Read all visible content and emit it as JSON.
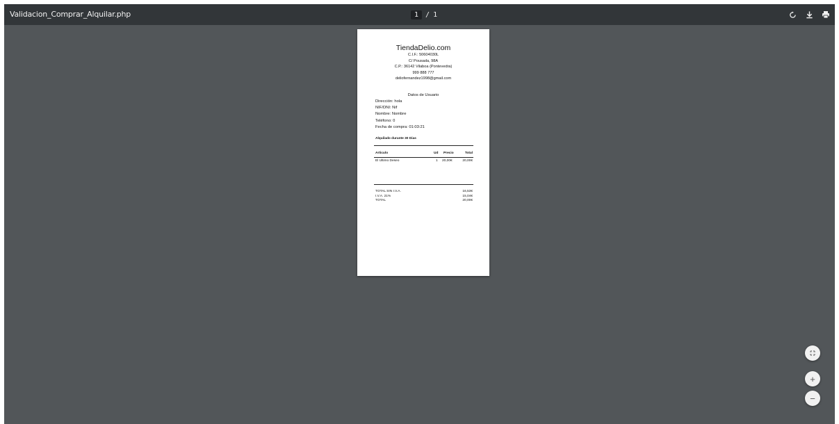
{
  "toolbar": {
    "title": "Validacion_Comprar_Alquilar.php",
    "current_page": "1",
    "page_separator": "/",
    "total_pages": "1",
    "icons": [
      "rotate-icon",
      "download-icon",
      "print-icon"
    ]
  },
  "document": {
    "shop_name": "TiendaDelio.com",
    "cif": "C.I.F.: 50604030L",
    "street": "C/ Pousada, 98A",
    "postal": "C.P.: 36142 Vilaboa (Pontevedra)",
    "phone": "999 888 777",
    "email": "deliofernandez1998@gmail.com",
    "user_section_title": "Datos de Usuario",
    "user": {
      "address": "Dirección: hola",
      "nif": "NIF/DNI: Nif",
      "name": "Nombre: Nombre",
      "phone": "Teléfono: 0",
      "date": "Fecha de compra: 01:03:21"
    },
    "rental_note": "Alquilado durante 30 Dias",
    "table": {
      "headers": [
        "Articulo",
        "Ud",
        "Precio",
        "Total"
      ],
      "rows": [
        [
          "El Ultimo Deseo",
          "1",
          "20,00€",
          "20,00€"
        ]
      ]
    },
    "totals": [
      {
        "label": "TOTAL SIN I.V.A.",
        "value": "16,53€"
      },
      {
        "label": "I.V.A. 21%",
        "value": "15,04€"
      },
      {
        "label": "TOTAL",
        "value": "20,00€"
      }
    ]
  },
  "controls": {
    "fit_icon": "fit-page-icon",
    "zoom_in": "+",
    "zoom_out": "−"
  },
  "colors": {
    "toolbar_bg": "#323639",
    "canvas_bg": "#525659",
    "page_bg": "#ffffff"
  }
}
